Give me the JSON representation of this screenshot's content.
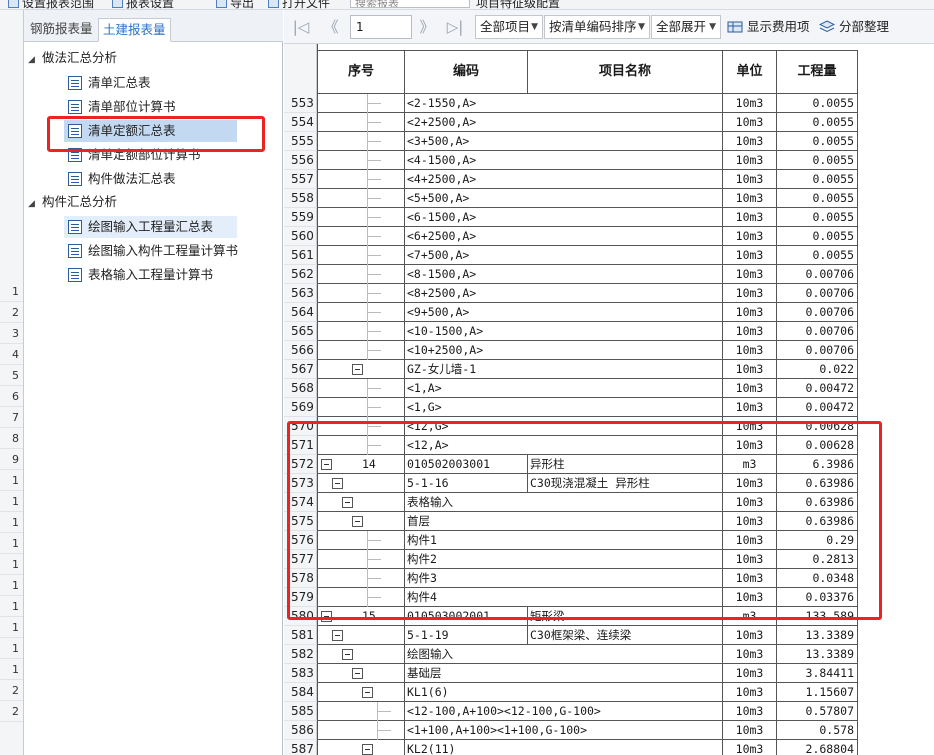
{
  "topbar": {
    "items": [
      "设置报表范围",
      "报表设置",
      "导出",
      "打开文件",
      "项目特征级配置"
    ],
    "search_placeholder": "搜索报表"
  },
  "leftstrip": {
    "rows": [
      "1",
      "2",
      "3",
      "4",
      "5",
      "6",
      "7",
      "8",
      "9",
      "1",
      "1",
      "1",
      "1",
      "1",
      "1",
      "1",
      "1",
      "1",
      "1",
      "2",
      "2"
    ]
  },
  "report_panel": {
    "tabs": [
      {
        "label": "钢筋报表量",
        "active": false
      },
      {
        "label": "土建报表量",
        "active": true
      }
    ],
    "groups": [
      {
        "label": "做法汇总分析",
        "items": [
          {
            "label": "清单汇总表",
            "selected": false
          },
          {
            "label": "清单部位计算书",
            "selected": false
          },
          {
            "label": "清单定额汇总表",
            "selected": true
          },
          {
            "label": "清单定额部位计算书",
            "selected": false
          },
          {
            "label": "构件做法汇总表",
            "selected": false
          }
        ]
      },
      {
        "label": "构件汇总分析",
        "items": [
          {
            "label": "绘图输入工程量汇总表",
            "selected": false,
            "hover": true
          },
          {
            "label": "绘图输入构件工程量计算书",
            "selected": false
          },
          {
            "label": "表格输入工程量计算书",
            "selected": false
          }
        ]
      }
    ]
  },
  "toolbar": {
    "nav_first": "|◁",
    "nav_prev": "《",
    "page_value": "1",
    "nav_next": "》",
    "nav_last": "▷|",
    "filter_all_items": "全部项目",
    "sort_by_code": "按清单编码排序",
    "expand_all": "全部展开",
    "show_fee_items": "显示费用项",
    "section_organize": "分部整理"
  },
  "table": {
    "headers": {
      "seq": "序号",
      "code": "编码",
      "name": "项目名称",
      "unit": "单位",
      "qty": "工程量"
    },
    "rows": [
      {
        "rn": "553",
        "seq": "",
        "code": "<2-1550,A>",
        "name": "",
        "unit": "10m3",
        "qty": "0.0055",
        "level": 4
      },
      {
        "rn": "554",
        "seq": "",
        "code": "<2+2500,A>",
        "name": "",
        "unit": "10m3",
        "qty": "0.0055",
        "level": 4
      },
      {
        "rn": "555",
        "seq": "",
        "code": "<3+500,A>",
        "name": "",
        "unit": "10m3",
        "qty": "0.0055",
        "level": 4
      },
      {
        "rn": "556",
        "seq": "",
        "code": "<4-1500,A>",
        "name": "",
        "unit": "10m3",
        "qty": "0.0055",
        "level": 4
      },
      {
        "rn": "557",
        "seq": "",
        "code": "<4+2500,A>",
        "name": "",
        "unit": "10m3",
        "qty": "0.0055",
        "level": 4
      },
      {
        "rn": "558",
        "seq": "",
        "code": "<5+500,A>",
        "name": "",
        "unit": "10m3",
        "qty": "0.0055",
        "level": 4
      },
      {
        "rn": "559",
        "seq": "",
        "code": "<6-1500,A>",
        "name": "",
        "unit": "10m3",
        "qty": "0.0055",
        "level": 4
      },
      {
        "rn": "560",
        "seq": "",
        "code": "<6+2500,A>",
        "name": "",
        "unit": "10m3",
        "qty": "0.0055",
        "level": 4
      },
      {
        "rn": "561",
        "seq": "",
        "code": "<7+500,A>",
        "name": "",
        "unit": "10m3",
        "qty": "0.0055",
        "level": 4
      },
      {
        "rn": "562",
        "seq": "",
        "code": "<8-1500,A>",
        "name": "",
        "unit": "10m3",
        "qty": "0.00706",
        "level": 4
      },
      {
        "rn": "563",
        "seq": "",
        "code": "<8+2500,A>",
        "name": "",
        "unit": "10m3",
        "qty": "0.00706",
        "level": 4
      },
      {
        "rn": "564",
        "seq": "",
        "code": "<9+500,A>",
        "name": "",
        "unit": "10m3",
        "qty": "0.00706",
        "level": 4
      },
      {
        "rn": "565",
        "seq": "",
        "code": "<10-1500,A>",
        "name": "",
        "unit": "10m3",
        "qty": "0.00706",
        "level": 4
      },
      {
        "rn": "566",
        "seq": "",
        "code": "<10+2500,A>",
        "name": "",
        "unit": "10m3",
        "qty": "0.00706",
        "level": 4
      },
      {
        "rn": "567",
        "seq": "",
        "code": "GZ-女儿墙-1",
        "name": "",
        "unit": "10m3",
        "qty": "0.022",
        "level": 3,
        "expander": true
      },
      {
        "rn": "568",
        "seq": "",
        "code": "<1,A>",
        "name": "",
        "unit": "10m3",
        "qty": "0.00472",
        "level": 4
      },
      {
        "rn": "569",
        "seq": "",
        "code": "<1,G>",
        "name": "",
        "unit": "10m3",
        "qty": "0.00472",
        "level": 4
      },
      {
        "rn": "570",
        "seq": "",
        "code": "<12,G>",
        "name": "",
        "unit": "10m3",
        "qty": "0.00628",
        "level": 4
      },
      {
        "rn": "571",
        "seq": "",
        "code": "<12,A>",
        "name": "",
        "unit": "10m3",
        "qty": "0.00628",
        "level": 4
      },
      {
        "rn": "572",
        "seq": "14",
        "code": "010502003001",
        "name": "异形柱",
        "unit": "m3",
        "qty": "6.3986",
        "level": 0,
        "expander": true
      },
      {
        "rn": "573",
        "seq": "",
        "code": "5-1-16",
        "name": "C30现浇混凝土 异形柱",
        "unit": "10m3",
        "qty": "0.63986",
        "level": 1,
        "expander": true
      },
      {
        "rn": "574",
        "seq": "",
        "code": "表格输入",
        "name": "",
        "unit": "10m3",
        "qty": "0.63986",
        "level": 2,
        "expander": true
      },
      {
        "rn": "575",
        "seq": "",
        "code": "首层",
        "name": "",
        "unit": "10m3",
        "qty": "0.63986",
        "level": 3,
        "expander": true
      },
      {
        "rn": "576",
        "seq": "",
        "code": "构件1",
        "name": "",
        "unit": "10m3",
        "qty": "0.29",
        "level": 4
      },
      {
        "rn": "577",
        "seq": "",
        "code": "构件2",
        "name": "",
        "unit": "10m3",
        "qty": "0.2813",
        "level": 4
      },
      {
        "rn": "578",
        "seq": "",
        "code": "构件3",
        "name": "",
        "unit": "10m3",
        "qty": "0.0348",
        "level": 4
      },
      {
        "rn": "579",
        "seq": "",
        "code": "构件4",
        "name": "",
        "unit": "10m3",
        "qty": "0.03376",
        "level": 4
      },
      {
        "rn": "580",
        "seq": "15",
        "code": "010503002001",
        "name": "矩形梁",
        "unit": "m3",
        "qty": "133.589",
        "level": 0,
        "expander": true
      },
      {
        "rn": "581",
        "seq": "",
        "code": "5-1-19",
        "name": "C30框架梁、连续梁",
        "unit": "10m3",
        "qty": "13.3389",
        "level": 1,
        "expander": true
      },
      {
        "rn": "582",
        "seq": "",
        "code": "绘图输入",
        "name": "",
        "unit": "10m3",
        "qty": "13.3389",
        "level": 2,
        "expander": true
      },
      {
        "rn": "583",
        "seq": "",
        "code": "基础层",
        "name": "",
        "unit": "10m3",
        "qty": "3.84411",
        "level": 3,
        "expander": true
      },
      {
        "rn": "584",
        "seq": "",
        "code": "KL1(6)",
        "name": "",
        "unit": "10m3",
        "qty": "1.15607",
        "level": 4,
        "expander": true
      },
      {
        "rn": "585",
        "seq": "",
        "code": "<12-100,A+100><12-100,G-100>",
        "name": "",
        "unit": "10m3",
        "qty": "0.57807",
        "level": 5
      },
      {
        "rn": "586",
        "seq": "",
        "code": "<1+100,A+100><1+100,G-100>",
        "name": "",
        "unit": "10m3",
        "qty": "0.578",
        "level": 5
      },
      {
        "rn": "587",
        "seq": "",
        "code": "KL2(11)",
        "name": "",
        "unit": "10m3",
        "qty": "2.68804",
        "level": 4,
        "expander": true
      }
    ]
  },
  "colors": {
    "highlight": "#ee2222",
    "tab_active_text": "#2e70c7",
    "selected_row": "#c3d8f1"
  }
}
